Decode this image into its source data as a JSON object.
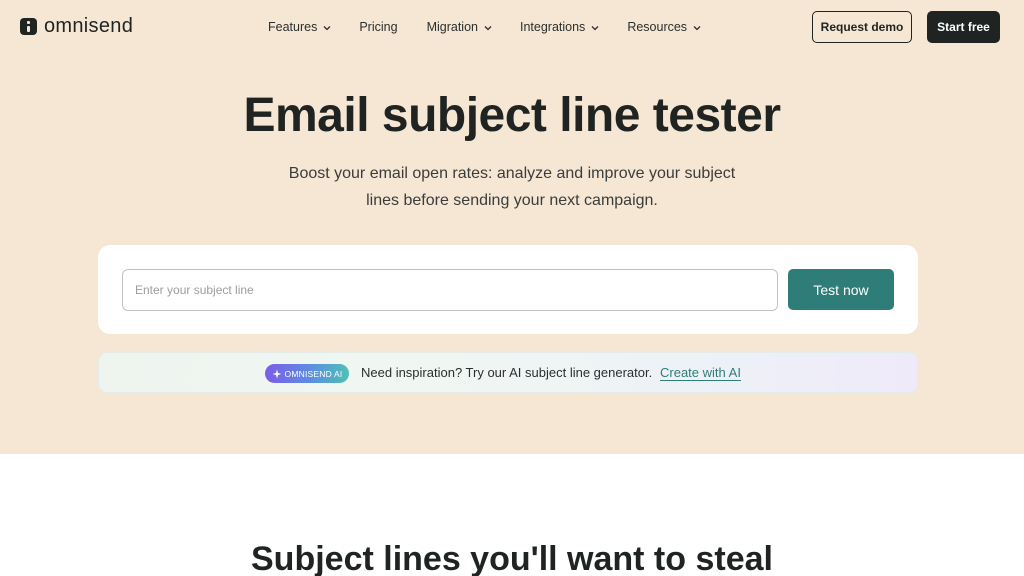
{
  "header": {
    "logo_text": "omnisend",
    "nav": [
      {
        "label": "Features",
        "has_dropdown": true
      },
      {
        "label": "Pricing",
        "has_dropdown": false
      },
      {
        "label": "Migration",
        "has_dropdown": true
      },
      {
        "label": "Integrations",
        "has_dropdown": true
      },
      {
        "label": "Resources",
        "has_dropdown": true
      }
    ],
    "request_demo_label": "Request demo",
    "start_free_label": "Start free"
  },
  "hero": {
    "title": "Email subject line tester",
    "subtitle_line1": "Boost your email open rates: analyze and improve your subject",
    "subtitle_line2": "lines before sending your next campaign."
  },
  "tester": {
    "input_value": "",
    "input_placeholder": "Enter your subject line",
    "button_label": "Test now"
  },
  "ai_promo": {
    "badge_label": "OMNISEND AI",
    "text": "Need inspiration? Try our AI subject line generator.",
    "link_label": "Create with AI"
  },
  "next_section": {
    "title": "Subject lines you'll want to steal"
  },
  "colors": {
    "hero_background": "#f6e6d4",
    "primary_dark": "#1f2321",
    "accent_teal": "#2e7d78",
    "card_background": "#ffffff"
  },
  "icons": {
    "chevron": "chevron-down-icon",
    "sparkle": "sparkle-icon",
    "logo": "omnisend-logo-icon"
  }
}
